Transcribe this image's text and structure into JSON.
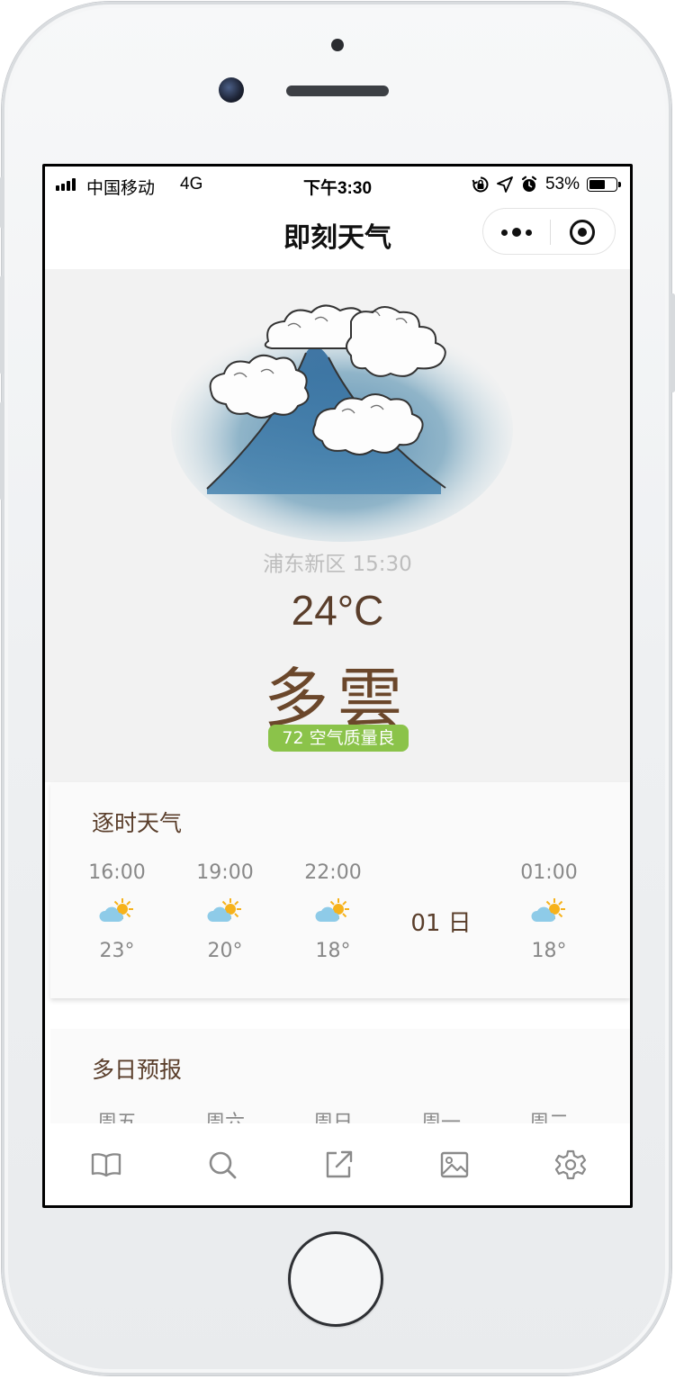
{
  "status_bar": {
    "carrier": "中国移动",
    "network": "4G",
    "time": "下午3:30",
    "battery": "53%",
    "battery_level": 0.53
  },
  "nav": {
    "title": "即刻天气",
    "more_icon": "more-dots-icon",
    "close_icon": "target-close-icon"
  },
  "current": {
    "location_time": "浦东新区 15:30",
    "temperature": "24°C",
    "condition": "多雲",
    "aqi": "72 空气质量良",
    "aqi_color": "#8bc34a"
  },
  "hourly": {
    "title": "逐时天气",
    "items": [
      {
        "time": "16:00",
        "icon": "partly-cloudy-icon",
        "temp": "23°"
      },
      {
        "time": "19:00",
        "icon": "partly-cloudy-icon",
        "temp": "20°"
      },
      {
        "time": "22:00",
        "icon": "partly-cloudy-icon",
        "temp": "18°"
      },
      {
        "day_marker": "01 日"
      },
      {
        "time": "01:00",
        "icon": "partly-cloudy-icon",
        "temp": "18°"
      }
    ]
  },
  "daily": {
    "title": "多日预报",
    "days": [
      "周五",
      "周六",
      "周日",
      "周一",
      "周二"
    ]
  },
  "tabbar": {
    "tabs": [
      {
        "icon": "book-icon"
      },
      {
        "icon": "search-icon"
      },
      {
        "icon": "share-icon"
      },
      {
        "icon": "image-icon"
      },
      {
        "icon": "gear-icon"
      }
    ]
  },
  "colors": {
    "brand_brown": "#5a3e2b",
    "hero_bg": "#f2f2f2",
    "sun": "#f6b21b",
    "cloud": "#8ecbe8"
  }
}
